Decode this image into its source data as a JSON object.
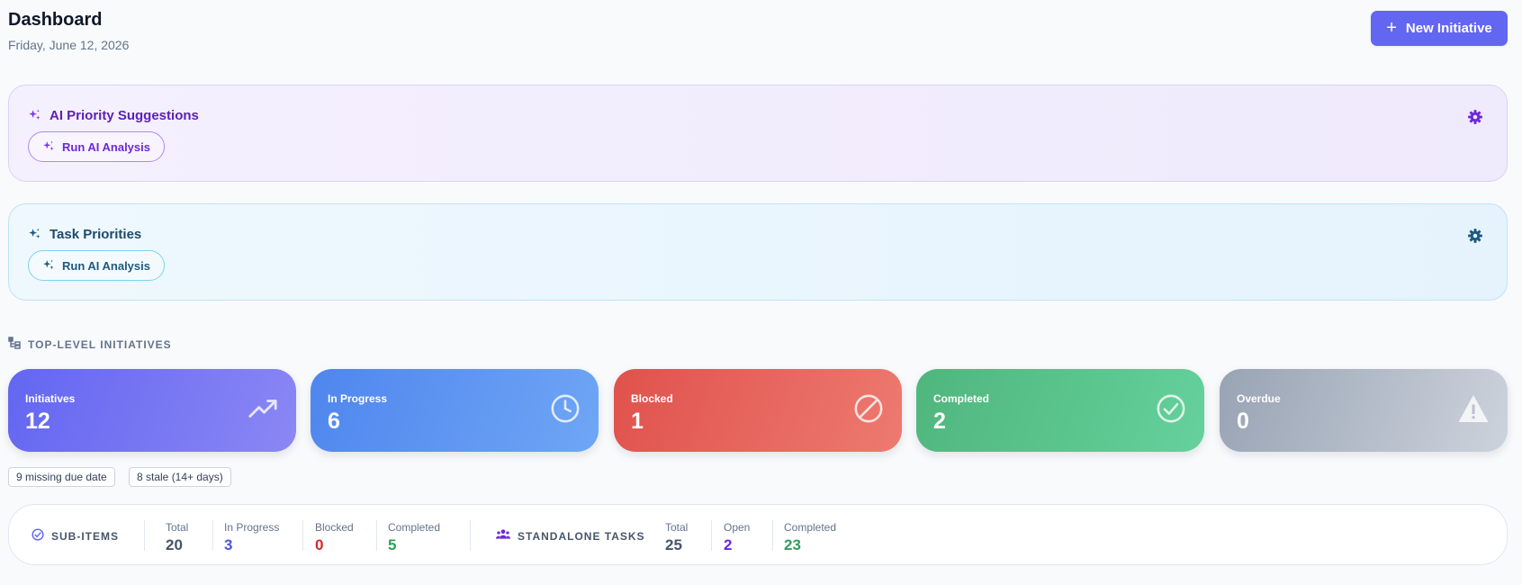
{
  "header": {
    "title": "Dashboard",
    "date": "Friday, June 12, 2026",
    "new_button_label": "New Initiative"
  },
  "ai_panels": [
    {
      "title": "AI Priority Suggestions",
      "button_label": "Run AI Analysis",
      "accent": "#6d28d9"
    },
    {
      "title": "Task Priorities",
      "button_label": "Run AI Analysis",
      "accent": "#1e5a80"
    }
  ],
  "initiatives": {
    "heading": "TOP-LEVEL INITIATIVES",
    "cards": [
      {
        "label": "Initiatives",
        "value": "12",
        "icon": "trending-up-icon",
        "color": "#6366f1"
      },
      {
        "label": "In Progress",
        "value": "6",
        "icon": "clock-icon",
        "color": "#4f86ee"
      },
      {
        "label": "Blocked",
        "value": "1",
        "icon": "blocked-icon",
        "color": "#e0524c"
      },
      {
        "label": "Completed",
        "value": "2",
        "icon": "check-circle-icon",
        "color": "#4fb67d"
      },
      {
        "label": "Overdue",
        "value": "0",
        "icon": "warning-icon",
        "color": "#98a3b4"
      }
    ],
    "chips": [
      "9 missing due date",
      "8 stale (14+ days)"
    ]
  },
  "summary": {
    "sub_items": {
      "heading": "SUB-ITEMS",
      "stats": [
        {
          "label": "Total",
          "value": "20",
          "color": "#475569"
        },
        {
          "label": "In Progress",
          "value": "3",
          "color": "#4f56d6"
        },
        {
          "label": "Blocked",
          "value": "0",
          "color": "#dc2626"
        },
        {
          "label": "Completed",
          "value": "5",
          "color": "#2f9e5b"
        }
      ]
    },
    "standalone": {
      "heading": "STANDALONE TASKS",
      "stats": [
        {
          "label": "Total",
          "value": "25",
          "color": "#475569"
        },
        {
          "label": "Open",
          "value": "2",
          "color": "#6d28d9"
        },
        {
          "label": "Completed",
          "value": "23",
          "color": "#2f9e5b"
        }
      ]
    }
  }
}
